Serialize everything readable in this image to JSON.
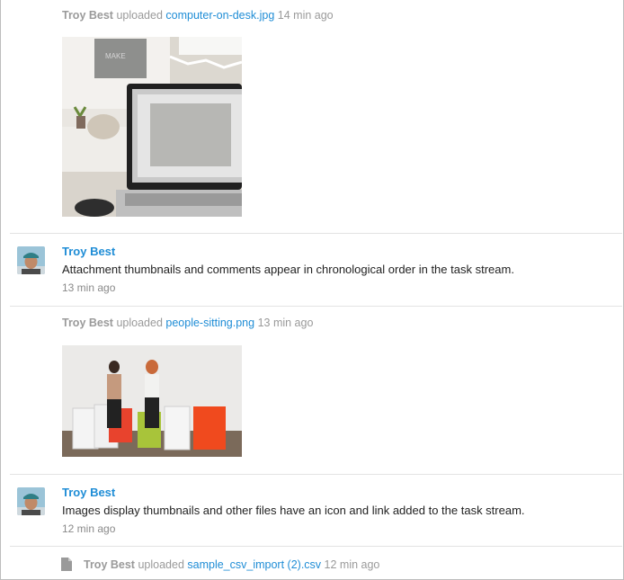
{
  "stream": {
    "upload1": {
      "user": "Troy Best",
      "action": "uploaded",
      "file": "computer-on-desk.jpg",
      "time": "14 min ago"
    },
    "comment1": {
      "author": "Troy Best",
      "text": "Attachment thumbnails and comments appear in chronological order in the task stream.",
      "time": "13 min ago"
    },
    "upload2": {
      "user": "Troy Best",
      "action": "uploaded",
      "file": "people-sitting.png",
      "time": "13 min ago"
    },
    "comment2": {
      "author": "Troy Best",
      "text": "Images display thumbnails and other files have an icon and link added to the task stream.",
      "time": "12 min ago"
    },
    "upload3": {
      "user": "Troy Best",
      "action": "uploaded",
      "file": "sample_csv_import (2).csv",
      "time": "12 min ago"
    }
  },
  "colors": {
    "link": "#1f8dd6",
    "muted": "#9a9a9a",
    "divider": "#e3e3e3"
  },
  "icons": {
    "file": "document-icon"
  }
}
